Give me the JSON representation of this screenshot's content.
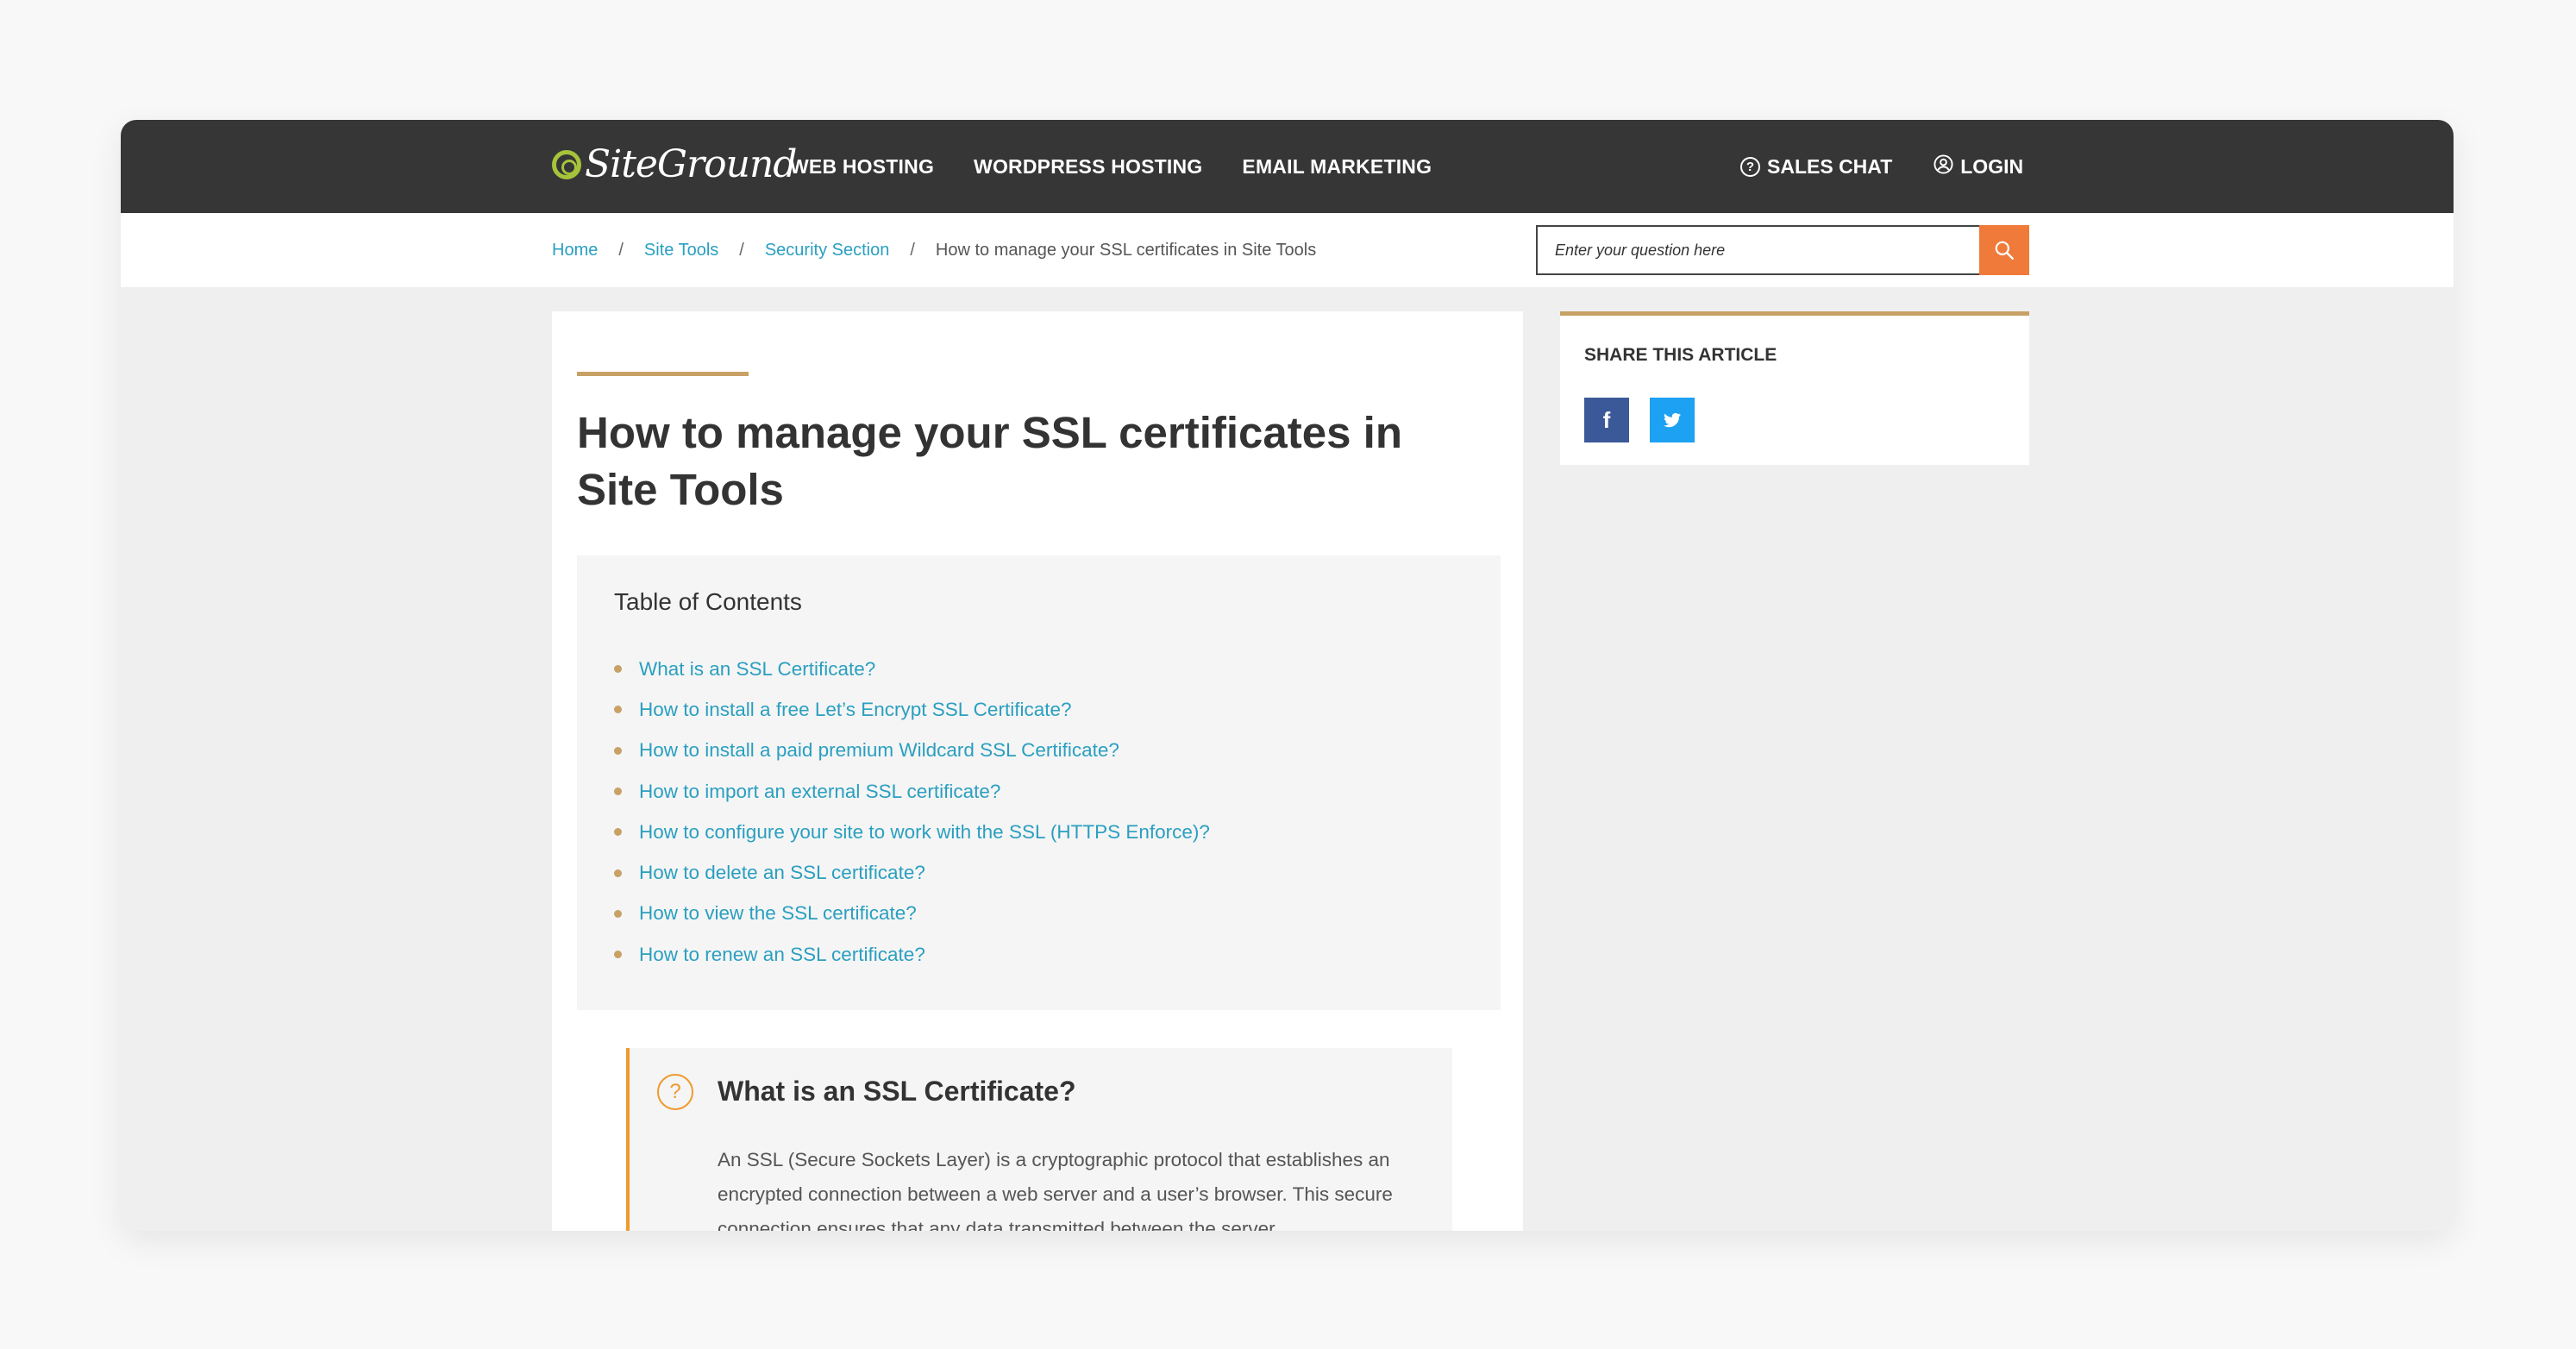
{
  "brand": {
    "logo_text": "SiteGround"
  },
  "nav": {
    "items": [
      {
        "label": "WEB HOSTING"
      },
      {
        "label": "WORDPRESS HOSTING"
      },
      {
        "label": "EMAIL MARKETING"
      }
    ],
    "sales_chat": "SALES CHAT",
    "login": "LOGIN"
  },
  "breadcrumb": {
    "items": [
      "Home",
      "Site Tools",
      "Security Section"
    ],
    "current": "How to manage your SSL certificates in Site Tools",
    "separator": "/"
  },
  "search": {
    "placeholder": "Enter your question here"
  },
  "article": {
    "title": "How to manage your SSL certificates in Site Tools",
    "toc": {
      "title": "Table of Contents",
      "items": [
        "What is an SSL Certificate?",
        "How to install a free Let’s Encrypt SSL Certificate?",
        "How to install a paid premium Wildcard SSL Certificate?",
        "How to import an external SSL certificate?",
        "How to configure your site to work with the SSL (HTTPS Enforce)?",
        "How to delete an SSL certificate?",
        "How to view the SSL certificate?",
        "How to renew an SSL certificate?"
      ]
    },
    "section": {
      "title": "What is an SSL Certificate?",
      "body": "An SSL (Secure Sockets Layer) is a cryptographic protocol that establishes an encrypted connection between a web server and a user’s browser. This secure connection ensures that any data transmitted between the server"
    }
  },
  "share": {
    "title": "SHARE THIS ARTICLE",
    "facebook": "f",
    "twitter": "t"
  },
  "colors": {
    "topbar": "#363636",
    "link": "#2a9fc0",
    "accent_gold": "#c7a165",
    "search_button": "#f07a3a",
    "callout": "#f09a2e"
  }
}
